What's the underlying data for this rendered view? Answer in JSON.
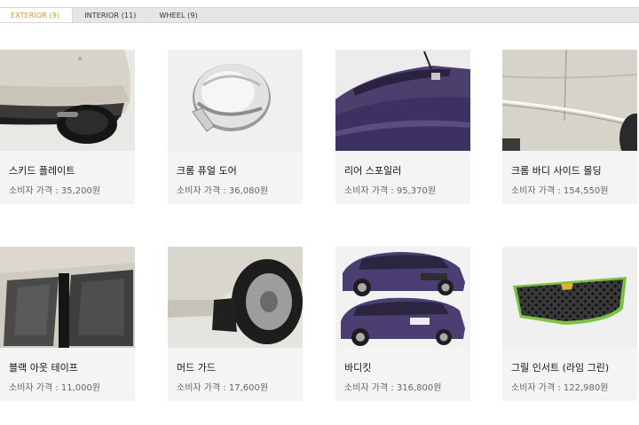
{
  "tabs": [
    {
      "label": "EXTERIOR (9)",
      "active": true
    },
    {
      "label": "INTERIOR (11)",
      "active": false
    },
    {
      "label": "WHEEL (9)",
      "active": false
    }
  ],
  "colors": {
    "accent": "#d29a1a",
    "card_bg": "#f4f4f4",
    "tab_bg": "#e6e6e6"
  },
  "price_label": "소비자 가격 : ",
  "products": [
    {
      "name": "스키드 플레이트",
      "price": "35,200원",
      "image": "skid-plate-photo"
    },
    {
      "name": "크롬 퓨얼 도어",
      "price": "36,080원",
      "image": "chrome-fuel-door-photo"
    },
    {
      "name": "리어 스포일러",
      "price": "95,370원",
      "image": "rear-spoiler-photo"
    },
    {
      "name": "크롬 바디 사이드 몰딩",
      "price": "154,550원",
      "image": "chrome-side-molding-photo"
    },
    {
      "name": "블랙 아웃 테이프",
      "price": "11,000원",
      "image": "blackout-tape-photo"
    },
    {
      "name": "머드 가드",
      "price": "17,600원",
      "image": "mud-guard-photo"
    },
    {
      "name": "바디킷",
      "price": "316,800원",
      "image": "body-kit-photo"
    },
    {
      "name": "그릴 인서트 (라임 그린)",
      "price": "122,980원",
      "image": "grille-insert-photo"
    }
  ]
}
